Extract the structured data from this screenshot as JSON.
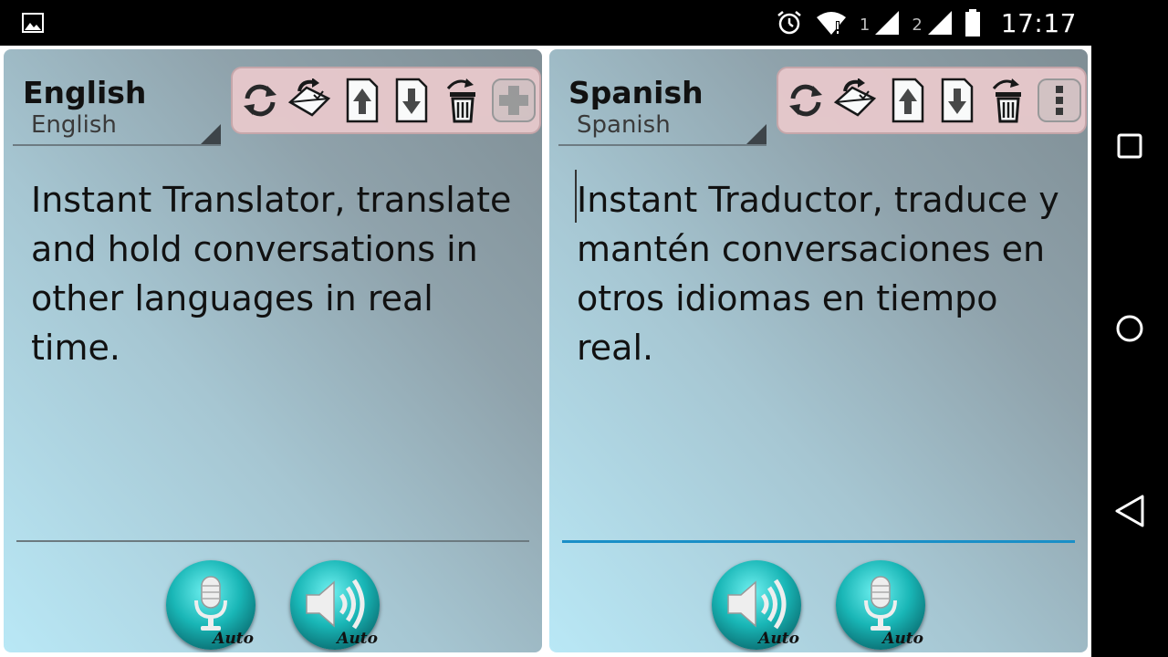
{
  "status_bar": {
    "time": "17:17",
    "sim1_label": "1",
    "sim2_label": "2",
    "icons": [
      "gallery-icon",
      "alarm-icon",
      "wifi-icon",
      "signal-icon",
      "battery-icon"
    ]
  },
  "left_panel": {
    "language_title": "English",
    "language_subtitle": "English",
    "toolbar_icons": [
      "refresh-icon",
      "share-icon",
      "upload-icon",
      "download-icon",
      "trash-icon",
      "add-icon"
    ],
    "text": "Instant Translator, translate and hold conversations in other languages in real time.",
    "buttons": [
      {
        "icon": "microphone-icon",
        "label": "Auto"
      },
      {
        "icon": "speaker-icon",
        "label": "Auto"
      }
    ]
  },
  "right_panel": {
    "language_title": "Spanish",
    "language_subtitle": "Spanish",
    "toolbar_icons": [
      "refresh-icon",
      "share-icon",
      "upload-icon",
      "download-icon",
      "trash-icon",
      "more-icon"
    ],
    "text": "Instant Traductor, traduce y  mantén conversaciones en otros idiomas en tiempo real.",
    "buttons": [
      {
        "icon": "speaker-icon",
        "label": "Auto"
      },
      {
        "icon": "microphone-icon",
        "label": "Auto"
      }
    ]
  },
  "nav_bar": {
    "icons": [
      "recents-icon",
      "home-icon",
      "back-icon"
    ]
  },
  "colors": {
    "toolbar_bg": "#e8c9cc",
    "active_underline": "#1a8fc7",
    "button_teal": "#19b6b6"
  }
}
